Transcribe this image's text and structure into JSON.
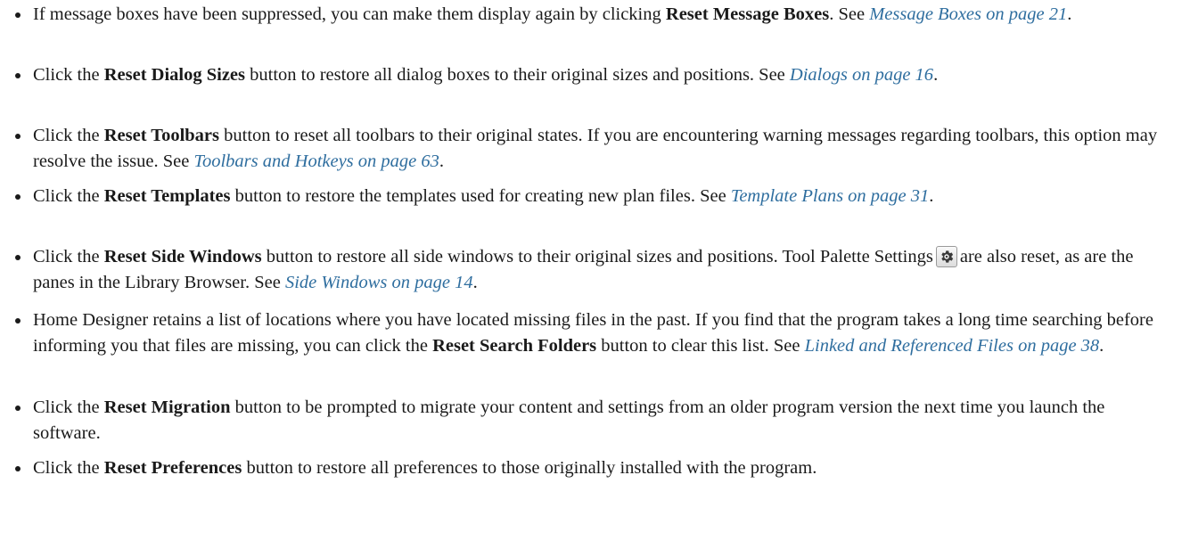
{
  "items": [
    {
      "pre": "If message boxes have been suppressed, you can make them display again by clicking ",
      "bold": "Reset Message Boxes",
      "post": ". See ",
      "link": "Message Boxes on page 21",
      "end": "."
    },
    {
      "pre": "Click the ",
      "bold": "Reset Dialog Sizes",
      "post": " button to restore all dialog boxes to their original sizes and positions. See ",
      "link": "Dialogs on page 16",
      "end": "."
    },
    {
      "pre": "Click the ",
      "bold": "Reset Toolbars",
      "post": " button to reset all toolbars to their original states. If you are encountering warning messages regarding toolbars, this option may resolve the issue. See ",
      "link": "Toolbars and Hotkeys on page 63",
      "end": "."
    },
    {
      "pre": "Click the ",
      "bold": "Reset Templates",
      "post": " button to restore the templates used for creating new plan files. See ",
      "link": "Template Plans on page 31",
      "end": "."
    },
    {
      "pre": "Click the ",
      "bold": "Reset Side Windows",
      "post": " button to restore all side windows to their original sizes and positions. Tool Palette Settings",
      "post2": "are also reset, as are the panes in the Library Browser. See ",
      "link": "Side Windows on page 14",
      "end": "."
    },
    {
      "pre": "Home Designer retains a list of locations where you have located missing files in the past. If you find that the program takes a long time searching before informing you that files are missing, you can click the ",
      "bold": "Reset Search Folders",
      "post": " button to clear this list. See ",
      "link": "Linked and Referenced Files on page 38",
      "end": "."
    },
    {
      "pre": "Click the ",
      "bold": "Reset Migration",
      "post": " button to be prompted to migrate your content and settings from an older program version the next time you launch the software."
    },
    {
      "pre": "Click the ",
      "bold": "Reset Preferences",
      "post": " button to restore all preferences to those originally installed with the program."
    }
  ],
  "icons": {
    "settings": "gear-icon"
  },
  "colors": {
    "text": "#1a1a1a",
    "link": "#2f6e9f"
  }
}
